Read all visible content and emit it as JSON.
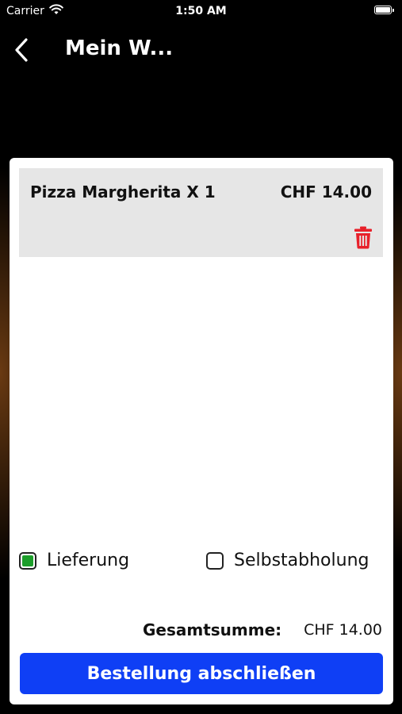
{
  "status_bar": {
    "carrier": "Carrier",
    "time": "1:50 AM"
  },
  "nav": {
    "title": "Mein W..."
  },
  "cart": {
    "items": [
      {
        "name": "Pizza Margherita X 1",
        "price": "CHF 14.00"
      }
    ]
  },
  "options": {
    "delivery_label": "Lieferung",
    "delivery_checked": true,
    "pickup_label": "Selbstabholung",
    "pickup_checked": false
  },
  "summary": {
    "total_label": "Gesamtsumme:",
    "total_value": "CHF 14.00"
  },
  "checkout": {
    "label": "Bestellung abschließen"
  },
  "colors": {
    "accent": "#0f3ff5",
    "checkbox_selected": "#1c9e2a",
    "delete": "#e8202a",
    "item_background": "#e6e6e6"
  },
  "icons": {
    "back": "chevron-left-icon",
    "delete": "trash-icon",
    "wifi": "wifi-icon",
    "battery": "battery-icon"
  }
}
